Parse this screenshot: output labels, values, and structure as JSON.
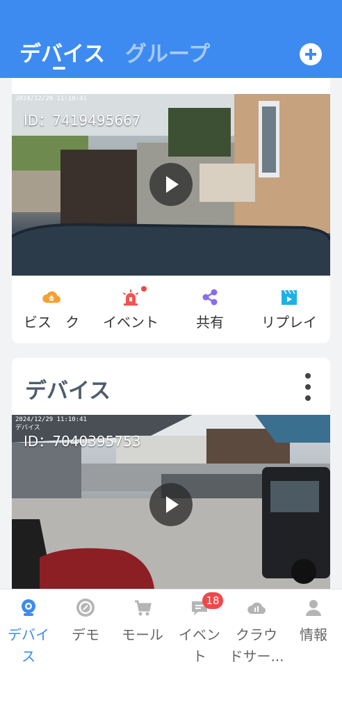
{
  "header": {
    "tabs": [
      {
        "label": "デバイス",
        "active": true
      },
      {
        "label": "グループ",
        "active": false
      }
    ]
  },
  "devices": [
    {
      "timestamp": "2024/12/29 11:10:41",
      "device_id": "ID：7419495667",
      "actions": [
        {
          "label": "ビス　ク",
          "icon": "cloud-service-icon",
          "color": "#f7a035"
        },
        {
          "label": "イベント",
          "icon": "alarm-siren-icon",
          "color": "#f05454",
          "dot": true
        },
        {
          "label": "共有",
          "icon": "share-icon",
          "color": "#8a6cf0"
        },
        {
          "label": "リプレイ",
          "icon": "replay-clapper-icon",
          "color": "#1fb0e6"
        }
      ]
    },
    {
      "title": "デバイス",
      "timestamp": "2024/12/29 11:10:41",
      "caption": "デバイス",
      "device_id": "ID：7040395753"
    }
  ],
  "bottom_nav": [
    {
      "label": "デバイ\nス",
      "icon": "camera-icon",
      "active": true
    },
    {
      "label": "デモ",
      "icon": "demo-icon"
    },
    {
      "label": "モール",
      "icon": "cart-icon"
    },
    {
      "label": "イベン\nト",
      "icon": "message-icon",
      "badge": "18"
    },
    {
      "label": "クラウ\nドサー...",
      "icon": "cloud-icon"
    },
    {
      "label": "情報",
      "icon": "user-icon"
    }
  ],
  "colors": {
    "primary": "#3d8bf0",
    "badge": "#f04848",
    "inactive": "#666666"
  }
}
